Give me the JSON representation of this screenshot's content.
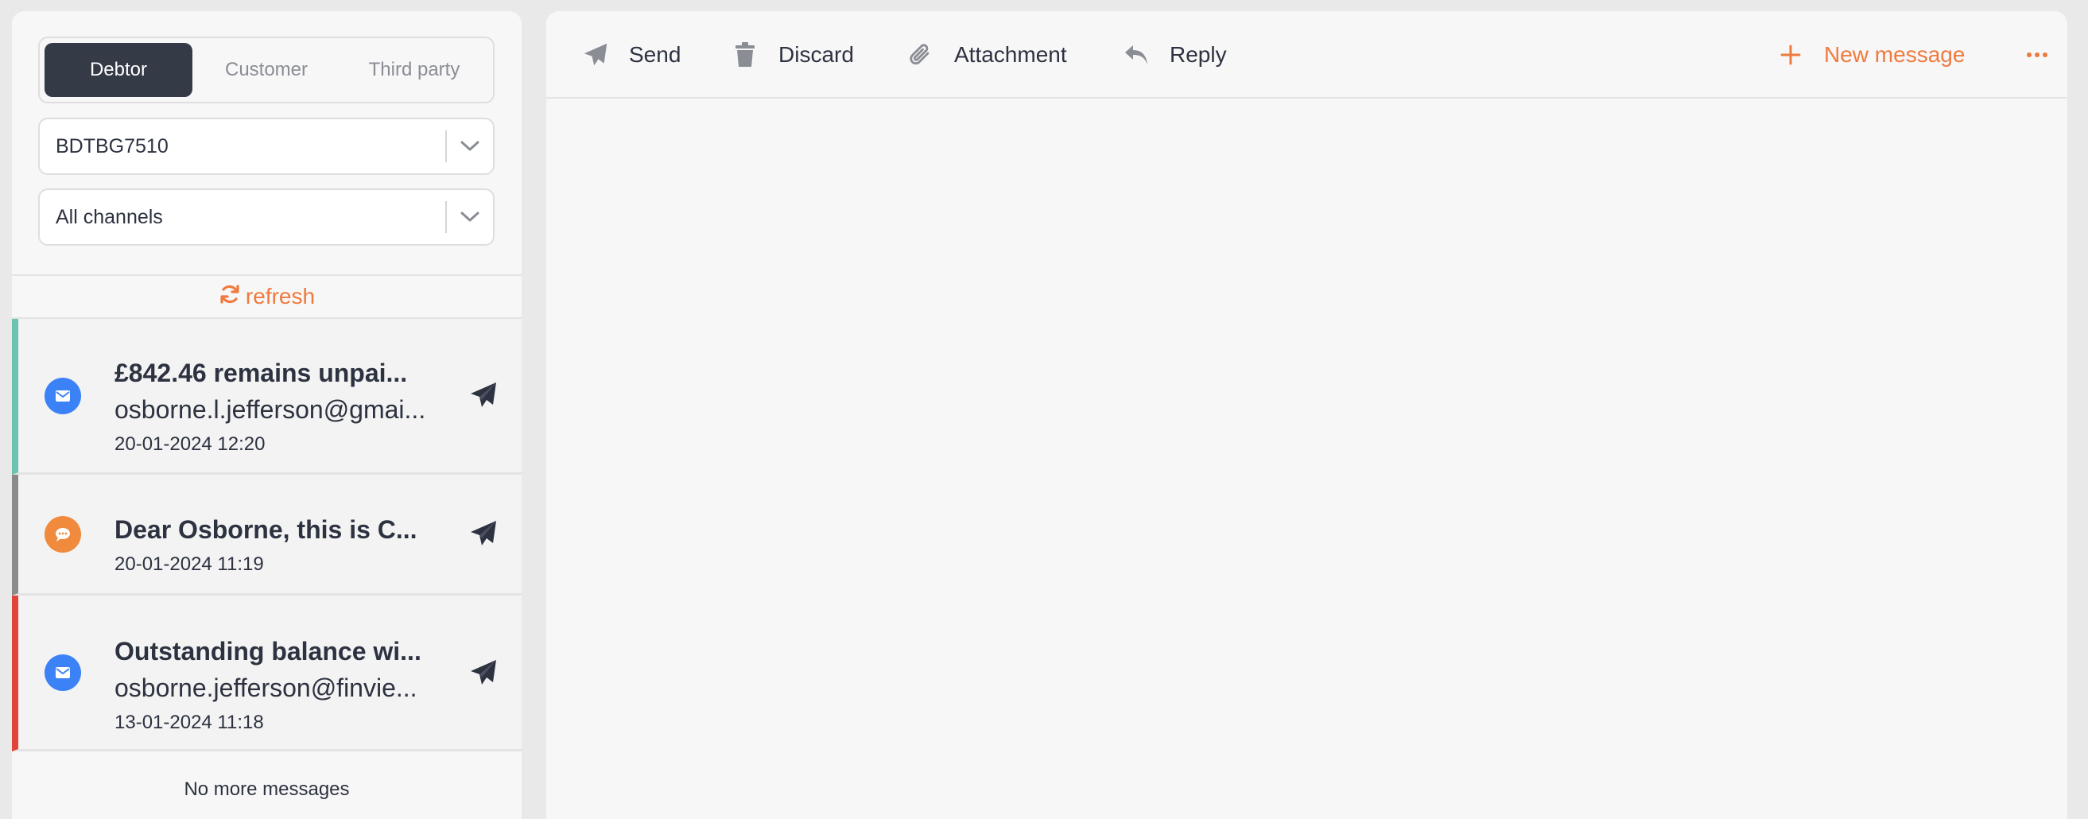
{
  "sidebar": {
    "tabs": [
      "Debtor",
      "Customer",
      "Third party"
    ],
    "active_tab": "Debtor",
    "reference_select": {
      "value": "BDTBG7510"
    },
    "channel_select": {
      "value": "All channels"
    },
    "refresh_label": "refresh",
    "messages": [
      {
        "channel": "email",
        "status_color": "#6cc4b0",
        "title": "£842.46 remains unpai...",
        "address": "osborne.l.jefferson@gmai...",
        "date": "20-01-2024 12:20"
      },
      {
        "channel": "sms",
        "status_color": "#8a8a8a",
        "title": "Dear Osborne, this is C...",
        "address": "",
        "date": "20-01-2024 11:19"
      },
      {
        "channel": "email",
        "status_color": "#e0453a",
        "title": "Outstanding balance wi...",
        "address": "osborne.jefferson@finvie...",
        "date": "13-01-2024 11:18"
      }
    ],
    "footer": "No more messages"
  },
  "toolbar": {
    "send_label": "Send",
    "discard_label": "Discard",
    "attachment_label": "Attachment",
    "reply_label": "Reply",
    "new_message_label": "New message"
  },
  "colors": {
    "accent": "#ef7a3e",
    "dark": "#343a46",
    "email_icon": "#3b82f6",
    "sms_icon": "#f08a3c"
  }
}
